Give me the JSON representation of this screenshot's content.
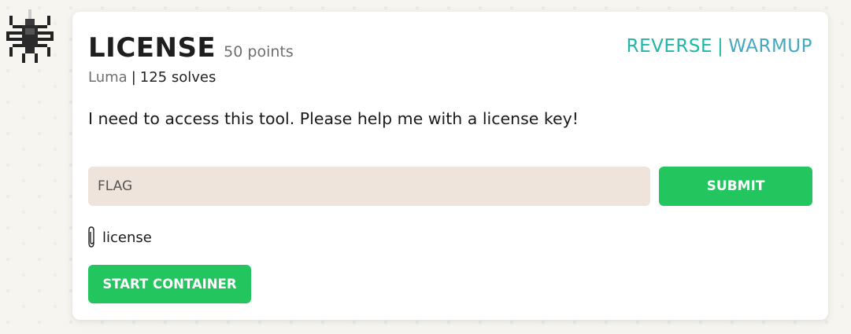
{
  "challenge": {
    "title": "LICENSE",
    "points": "50 points",
    "categories": [
      "REVERSE",
      "WARMUP"
    ],
    "category_separator": "|",
    "author": "Luma",
    "meta_separator": "|",
    "solves": "125 solves",
    "description": "I need to access this tool. Please help me with a license key!"
  },
  "flag_form": {
    "placeholder": "FLAG",
    "submit_label": "SUBMIT"
  },
  "attachment": {
    "icon": "paperclip-icon",
    "filename": "license"
  },
  "container": {
    "start_label": "START CONTAINER"
  },
  "avatar": {
    "icon": "pixel-spider-icon"
  },
  "colors": {
    "accent_green": "#22c55e",
    "tag_teal": "#20b7a6",
    "tag_blue": "#45a7c0",
    "input_bg": "#eee4dc"
  }
}
